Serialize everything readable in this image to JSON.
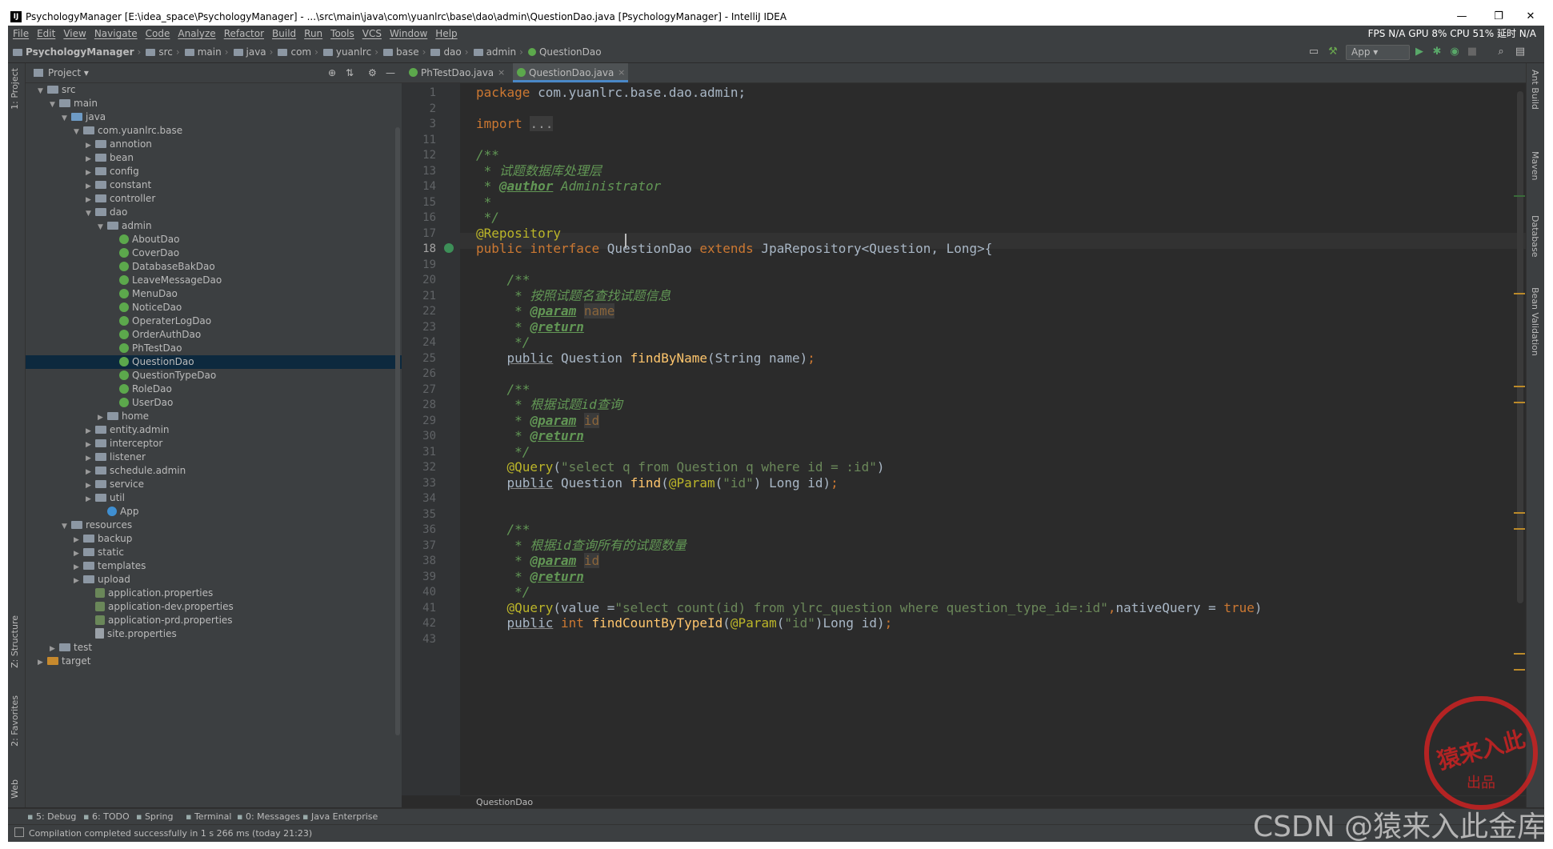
{
  "window": {
    "title": "PsychologyManager [E:\\idea_space\\PsychologyManager] - ...\\src\\main\\java\\com\\yuanlrc\\base\\dao\\admin\\QuestionDao.java [PsychologyManager] - IntelliJ IDEA",
    "controls": {
      "minimize": "—",
      "restore": "❐",
      "close": "✕"
    }
  },
  "menu": {
    "items": [
      "File",
      "Edit",
      "View",
      "Navigate",
      "Code",
      "Analyze",
      "Refactor",
      "Build",
      "Run",
      "Tools",
      "VCS",
      "Window",
      "Help"
    ],
    "stats": "FPS N/A GPU 8% CPU 51% 延时 N/A"
  },
  "breadcrumb": {
    "items": [
      "PsychologyManager",
      "src",
      "main",
      "java",
      "com",
      "yuanlrc",
      "base",
      "dao",
      "admin",
      "QuestionDao"
    ],
    "run_config": "App"
  },
  "left_strip": {
    "project": "1: Project",
    "structure": "Z: Structure",
    "favorites": "2: Favorites",
    "web": "Web"
  },
  "right_strip": {
    "ant": "Ant Build",
    "maven": "Maven",
    "database": "Database",
    "bean": "Bean Validation"
  },
  "project_panel": {
    "title": "Project",
    "tree": [
      {
        "label": "src",
        "depth": 1,
        "expanded": true,
        "type": "folder"
      },
      {
        "label": "main",
        "depth": 2,
        "expanded": true,
        "type": "folder"
      },
      {
        "label": "java",
        "depth": 3,
        "expanded": true,
        "type": "folderb"
      },
      {
        "label": "com.yuanlrc.base",
        "depth": 4,
        "expanded": true,
        "type": "folder"
      },
      {
        "label": "annotion",
        "depth": 5,
        "expanded": false,
        "type": "folder"
      },
      {
        "label": "bean",
        "depth": 5,
        "expanded": false,
        "type": "folder"
      },
      {
        "label": "config",
        "depth": 5,
        "expanded": false,
        "type": "folder"
      },
      {
        "label": "constant",
        "depth": 5,
        "expanded": false,
        "type": "folder"
      },
      {
        "label": "controller",
        "depth": 5,
        "expanded": false,
        "type": "folder"
      },
      {
        "label": "dao",
        "depth": 5,
        "expanded": true,
        "type": "folder"
      },
      {
        "label": "admin",
        "depth": 6,
        "expanded": true,
        "type": "folder"
      },
      {
        "label": "AboutDao",
        "depth": 7,
        "type": "iface"
      },
      {
        "label": "CoverDao",
        "depth": 7,
        "type": "iface"
      },
      {
        "label": "DatabaseBakDao",
        "depth": 7,
        "type": "iface"
      },
      {
        "label": "LeaveMessageDao",
        "depth": 7,
        "type": "iface"
      },
      {
        "label": "MenuDao",
        "depth": 7,
        "type": "iface"
      },
      {
        "label": "NoticeDao",
        "depth": 7,
        "type": "iface"
      },
      {
        "label": "OperaterLogDao",
        "depth": 7,
        "type": "iface"
      },
      {
        "label": "OrderAuthDao",
        "depth": 7,
        "type": "iface"
      },
      {
        "label": "PhTestDao",
        "depth": 7,
        "type": "iface"
      },
      {
        "label": "QuestionDao",
        "depth": 7,
        "type": "iface",
        "selected": true
      },
      {
        "label": "QuestionTypeDao",
        "depth": 7,
        "type": "iface"
      },
      {
        "label": "RoleDao",
        "depth": 7,
        "type": "iface"
      },
      {
        "label": "UserDao",
        "depth": 7,
        "type": "iface"
      },
      {
        "label": "home",
        "depth": 6,
        "expanded": false,
        "type": "folder"
      },
      {
        "label": "entity.admin",
        "depth": 5,
        "expanded": false,
        "type": "folder"
      },
      {
        "label": "interceptor",
        "depth": 5,
        "expanded": false,
        "type": "folder"
      },
      {
        "label": "listener",
        "depth": 5,
        "expanded": false,
        "type": "folder"
      },
      {
        "label": "schedule.admin",
        "depth": 5,
        "expanded": false,
        "type": "folder"
      },
      {
        "label": "service",
        "depth": 5,
        "expanded": false,
        "type": "folder"
      },
      {
        "label": "util",
        "depth": 5,
        "expanded": false,
        "type": "folder"
      },
      {
        "label": "App",
        "depth": 6,
        "type": "app"
      },
      {
        "label": "resources",
        "depth": 3,
        "expanded": true,
        "type": "folder"
      },
      {
        "label": "backup",
        "depth": 4,
        "expanded": false,
        "type": "folder"
      },
      {
        "label": "static",
        "depth": 4,
        "expanded": false,
        "type": "folder"
      },
      {
        "label": "templates",
        "depth": 4,
        "expanded": false,
        "type": "folder"
      },
      {
        "label": "upload",
        "depth": 4,
        "expanded": false,
        "type": "folder"
      },
      {
        "label": "application.properties",
        "depth": 5,
        "type": "props"
      },
      {
        "label": "application-dev.properties",
        "depth": 5,
        "type": "props"
      },
      {
        "label": "application-prd.properties",
        "depth": 5,
        "type": "props"
      },
      {
        "label": "site.properties",
        "depth": 5,
        "type": "fileg"
      },
      {
        "label": "test",
        "depth": 2,
        "expanded": false,
        "type": "folder"
      },
      {
        "label": "target",
        "depth": 1,
        "expanded": false,
        "type": "foldero"
      }
    ]
  },
  "tabs": [
    {
      "label": "PhTestDao.java",
      "active": false
    },
    {
      "label": "QuestionDao.java",
      "active": true
    }
  ],
  "code_lines": [
    {
      "n": "1",
      "html": "<span class=\"k\">package</span> com.yuanlrc.base.dao.admin;"
    },
    {
      "n": "2",
      "html": ""
    },
    {
      "n": "3",
      "html": "<span class=\"k\">import</span> <span class=\"fold\">...</span>"
    },
    {
      "n": "11",
      "html": ""
    },
    {
      "n": "12",
      "html": "<span class=\"c\">/**</span>"
    },
    {
      "n": "13",
      "html": "<span class=\"c\"> * 试题数据库处理层</span>"
    },
    {
      "n": "14",
      "html": "<span class=\"c\"> * </span><span class=\"tag\">@author</span><span class=\"c\"> Administrator</span>"
    },
    {
      "n": "15",
      "html": "<span class=\"c\"> *</span>"
    },
    {
      "n": "16",
      "html": "<span class=\"c\"> */</span>"
    },
    {
      "n": "17",
      "html": "<span class=\"ann\">@Repository</span>"
    },
    {
      "n": "18",
      "html": "<span class=\"k\">public interface</span> QuestionDao <span class=\"k\">extends</span> JpaRepository&lt;Question, Long&gt;{"
    },
    {
      "n": "19",
      "html": ""
    },
    {
      "n": "20",
      "html": "    <span class=\"c\">/**</span>"
    },
    {
      "n": "21",
      "html": "<span class=\"c\">     * 按照试题名查找试题信息</span>"
    },
    {
      "n": "22",
      "html": "<span class=\"c\">     * </span><span class=\"tag\">@param</span><span class=\"c\"> </span><span class=\"pn\">name</span>"
    },
    {
      "n": "23",
      "html": "<span class=\"c\">     * </span><span class=\"tag\">@return</span>"
    },
    {
      "n": "24",
      "html": "<span class=\"c\">     */</span>"
    },
    {
      "n": "25",
      "html": "    <span class=\"ul\">public</span> Question <span class=\"fn\">findByName</span>(String name)<span class=\"k\">;</span>"
    },
    {
      "n": "26",
      "html": ""
    },
    {
      "n": "27",
      "html": "    <span class=\"c\">/**</span>"
    },
    {
      "n": "28",
      "html": "<span class=\"c\">     * 根据试题id查询</span>"
    },
    {
      "n": "29",
      "html": "<span class=\"c\">     * </span><span class=\"tag\">@param</span><span class=\"c\"> </span><span class=\"pn\">id</span>"
    },
    {
      "n": "30",
      "html": "<span class=\"c\">     * </span><span class=\"tag\">@return</span>"
    },
    {
      "n": "31",
      "html": "<span class=\"c\">     */</span>"
    },
    {
      "n": "32",
      "html": "    <span class=\"ann\">@Query</span>(<span class=\"s\">\"select q from Question q where id = :id\"</span>)"
    },
    {
      "n": "33",
      "html": "    <span class=\"ul\">public</span> Question <span class=\"fn\">find</span>(<span class=\"ann\">@Param</span>(<span class=\"s\">\"id\"</span>) Long id)<span class=\"k\">;</span>"
    },
    {
      "n": "34",
      "html": ""
    },
    {
      "n": "35",
      "html": ""
    },
    {
      "n": "36",
      "html": "    <span class=\"c\">/**</span>"
    },
    {
      "n": "37",
      "html": "<span class=\"c\">     * 根据id查询所有的试题数量</span>"
    },
    {
      "n": "38",
      "html": "<span class=\"c\">     * </span><span class=\"tag\">@param</span><span class=\"c\"> </span><span class=\"pn\">id</span>"
    },
    {
      "n": "39",
      "html": "<span class=\"c\">     * </span><span class=\"tag\">@return</span>"
    },
    {
      "n": "40",
      "html": "<span class=\"c\">     */</span>"
    },
    {
      "n": "41",
      "html": "    <span class=\"ann\">@Query</span>(value =<span class=\"s\">\"select count(id) from ylrc_question where question_type_id=:id\"</span><span class=\"k\">,</span>nativeQuery = <span class=\"k\">true</span>)"
    },
    {
      "n": "42",
      "html": "    <span class=\"ul\">public</span> <span class=\"k\">int</span> <span class=\"fn\">findCountByTypeId</span>(<span class=\"ann\">@Param</span>(<span class=\"s\">\"id\"</span>)Long id)<span class=\"k\">;</span>"
    },
    {
      "n": "43",
      "html": ""
    }
  ],
  "editor_footer": "QuestionDao",
  "bottom_tabs": [
    "5: Debug",
    "6: TODO",
    "Spring",
    "Terminal",
    "0: Messages",
    "Java Enterprise"
  ],
  "status": "Compilation completed successfully in 1 s 266 ms (today 21:23)",
  "stamp": {
    "line1": "猿来入此",
    "line2": "出品"
  },
  "watermark": "CSDN @猿来入此金库"
}
